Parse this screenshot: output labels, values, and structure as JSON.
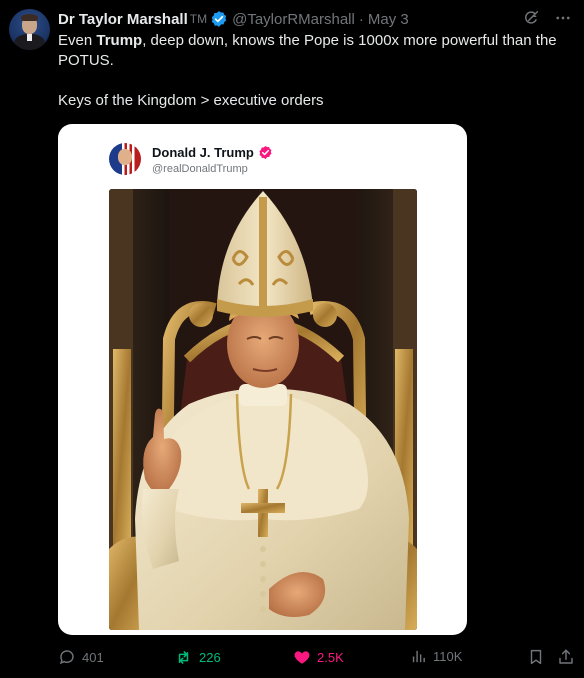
{
  "author": {
    "name": "Dr Taylor Marshall",
    "tm": "TM",
    "handle": "@TaylorRMarshall",
    "date": "May 3",
    "separator": "·"
  },
  "tweet": {
    "line1_pre": "Even ",
    "line1_bold": "Trump",
    "line1_post": ", deep down, knows the Pope is 1000x more powerful than the POTUS.",
    "line2": "Keys of the Kingdom > executive orders"
  },
  "embedded": {
    "name": "Donald J. Trump",
    "handle": "@realDonaldTrump"
  },
  "actions": {
    "replies": "401",
    "reposts": "226",
    "likes": "2.5K",
    "views": "110K"
  },
  "colors": {
    "verified_blue": "#1d9bf0",
    "verified_pink": "#f91880",
    "repost_green": "#00ba7c",
    "like_pink": "#f91880",
    "muted": "#71767b"
  },
  "icons": [
    "grok-icon",
    "more-icon",
    "verified-icon",
    "reply-icon",
    "repost-icon",
    "like-icon",
    "views-icon",
    "bookmark-icon",
    "share-icon"
  ]
}
